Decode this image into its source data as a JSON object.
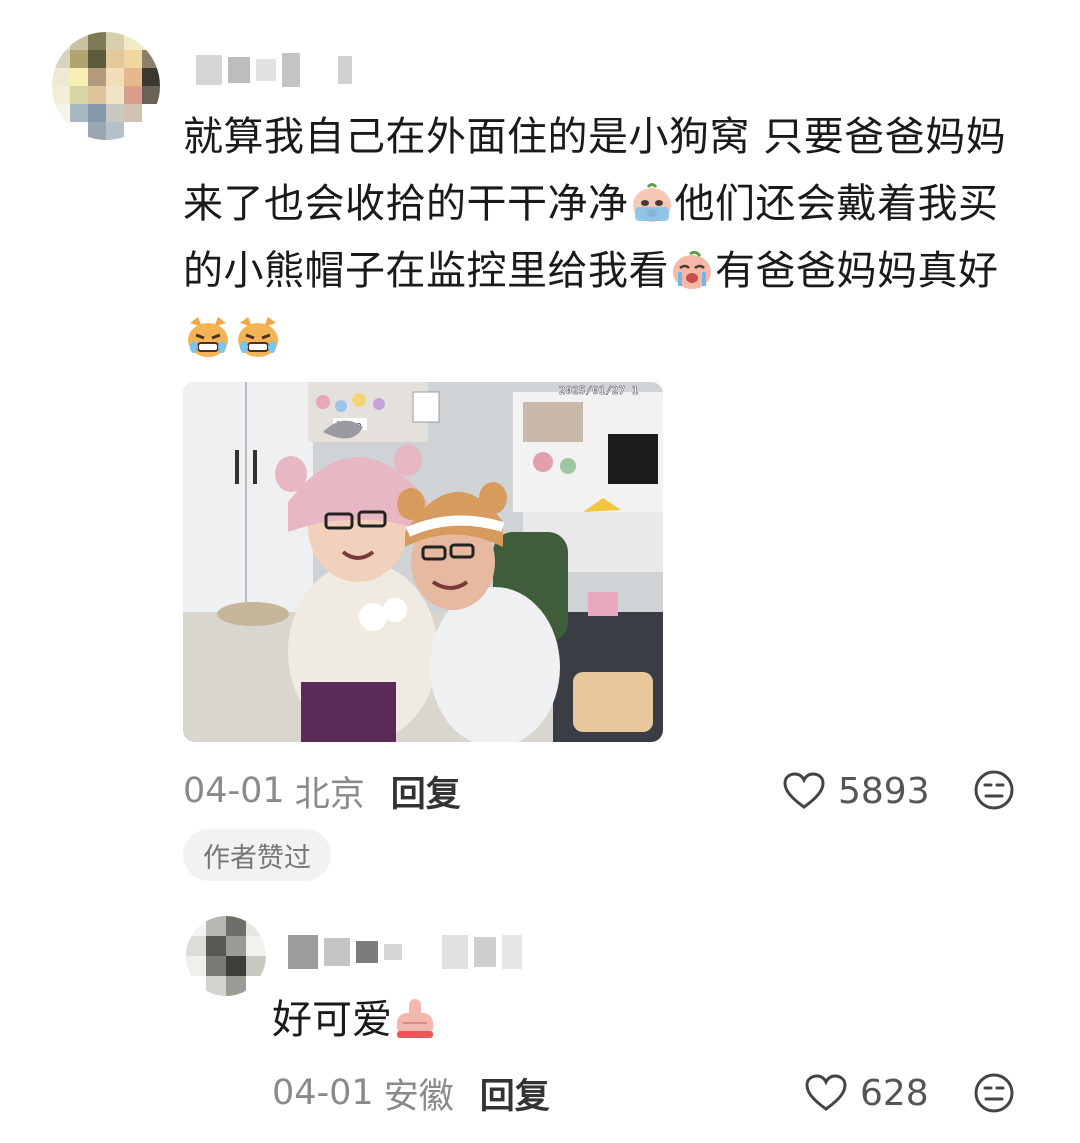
{
  "main_comment": {
    "text_line1": "就算我自己在外面住的是小狗窝 只要爸爸妈妈",
    "text_line2a": "来了也会收拾的干干净净",
    "text_line2b": "他们还会戴着我买",
    "text_line3a": "的小熊帽子在监控里给我看",
    "text_line3b": "有爸爸妈妈真好",
    "emojis": [
      "crying-face-emoji",
      "crying-peach-emoji",
      "crying-cat-emoji",
      "crying-cat-emoji"
    ],
    "photo_timestamp": "2025/01/27 1",
    "photo_brand": "Tiboo",
    "date": "04-01",
    "location": "北京",
    "reply_label": "回复",
    "like_count": "5893",
    "author_liked_label": "作者赞过"
  },
  "reply_comment": {
    "text": "好可爱",
    "emoji": "thumbs-up-emoji",
    "date": "04-01",
    "location": "安徽",
    "reply_label": "回复",
    "like_count": "628"
  },
  "colors": {
    "text": "#1a1a1a",
    "meta_gray": "#8a8a8a",
    "tag_bg": "#f2f2f2",
    "avatar_blur": "#cfcfcf"
  }
}
